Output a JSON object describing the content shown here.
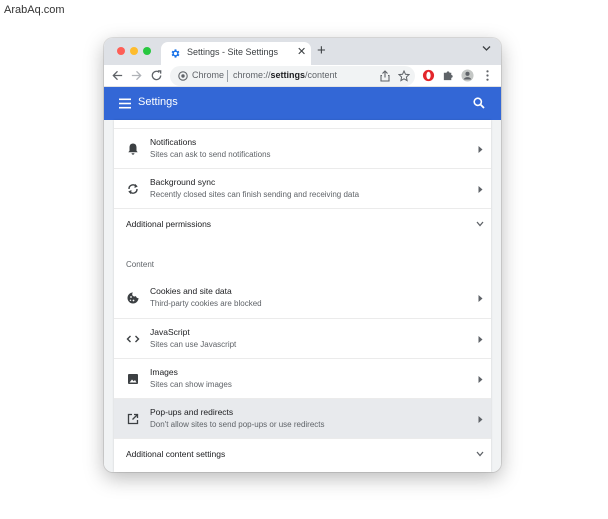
{
  "watermark": "ArabAq.com",
  "tab": {
    "title": "Settings - Site Settings",
    "close": "✕"
  },
  "new_tab": "+",
  "omnibox": {
    "site_name": "Chrome",
    "url_prefix": "chrome://",
    "url_bold": "settings",
    "url_suffix": "/content"
  },
  "header": {
    "title": "Settings"
  },
  "rows_permissions": [
    {
      "icon": "bell-icon",
      "title": "Notifications",
      "subtitle": "Sites can ask to send notifications"
    },
    {
      "icon": "sync-icon",
      "title": "Background sync",
      "subtitle": "Recently closed sites can finish sending and receiving data"
    }
  ],
  "additional_permissions": "Additional permissions",
  "content_section": "Content",
  "rows_content": [
    {
      "icon": "cookie-icon",
      "title": "Cookies and site data",
      "subtitle": "Third-party cookies are blocked"
    },
    {
      "icon": "code-icon",
      "title": "JavaScript",
      "subtitle": "Sites can use Javascript"
    },
    {
      "icon": "image-icon",
      "title": "Images",
      "subtitle": "Sites can show images"
    },
    {
      "icon": "open-in-new-icon",
      "title": "Pop-ups and redirects",
      "subtitle": "Don't allow sites to send pop-ups or use redirects"
    }
  ],
  "additional_content_settings": "Additional content settings",
  "colors": {
    "header": "#3367d6",
    "active_row": "#e8eaed",
    "opera_red": "#e3262b"
  }
}
